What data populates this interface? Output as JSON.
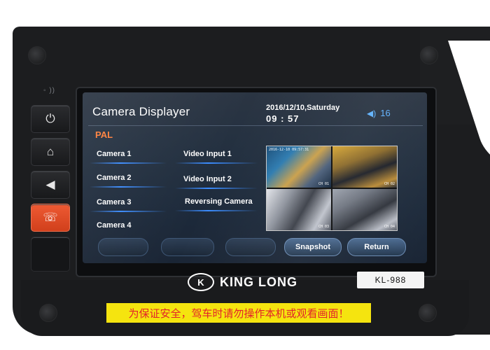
{
  "side_buttons": [
    {
      "icon": "power-icon",
      "glyph": "⏻"
    },
    {
      "icon": "home-icon",
      "glyph": "⌂"
    },
    {
      "icon": "speaker-icon",
      "glyph": "◀"
    },
    {
      "icon": "phone-icon",
      "glyph": "☏"
    },
    {
      "icon": "blank",
      "glyph": ""
    }
  ],
  "screen": {
    "title": "Camera Displayer",
    "date": "2016/12/10,Saturday",
    "time": "09 : 57",
    "volume": "16",
    "signal": "PAL",
    "cameras": [
      "Camera  1",
      "Camera  2",
      "Camera  3",
      "Camera  4"
    ],
    "inputs": [
      "Video Input  1",
      "Video Input  2",
      "Reversing Camera"
    ],
    "feeds": [
      {
        "timestamp": "2016-12-10 09:57:31",
        "channel": "CH 01"
      },
      {
        "timestamp": "",
        "channel": "CH 02"
      },
      {
        "timestamp": "",
        "channel": "CH 03"
      },
      {
        "timestamp": "",
        "channel": "CH 04"
      }
    ],
    "buttons": {
      "snapshot": "Snapshot",
      "return": "Return"
    }
  },
  "brand": "KING LONG",
  "model": "KL-988",
  "warning": "为保证安全，驾车时请勿操作本机或观看画面！",
  "colors": {
    "accent_blue": "#5fb2ff",
    "signal_orange": "#ff7f3a",
    "call_button": "#e04a25",
    "warning_bg": "#f5e40f",
    "warning_text": "#e3222a"
  }
}
